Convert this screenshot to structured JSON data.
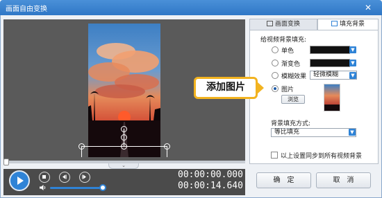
{
  "window": {
    "title": "画面自由变换",
    "close_symbol": "✕"
  },
  "video": {
    "timecode_current": "00:00:00.000",
    "timecode_total": "00:00:14.640",
    "expand_symbol": "⌄"
  },
  "tabs": {
    "transform": "画面变换",
    "fill_background": "填充背景"
  },
  "fill": {
    "section_title": "给视频背景填充:",
    "options": {
      "solid": "单色",
      "gradient": "渐变色",
      "blur": "模糊效果",
      "image": "图片"
    },
    "selected": "image",
    "blur_select_value": "轻微模糊",
    "browse_label": "浏览",
    "fill_mode_title": "背景填充方式:",
    "fill_mode_value": "等比填充",
    "sync_label": "以上设置同步到所有视频背景"
  },
  "buttons": {
    "ok": "确　定",
    "cancel": "取　消"
  },
  "callout": {
    "text": "添加图片"
  },
  "colors": {
    "accent": "#2f83d6",
    "callout_border": "#f2b320",
    "titlebar": "#2f77c6"
  },
  "icons": {
    "play": "play-icon",
    "stop": "stop-icon",
    "prev": "prev-frame-icon",
    "next": "next-frame-icon",
    "volume": "volume-icon",
    "transform": "transform-icon",
    "fill": "fill-icon"
  }
}
